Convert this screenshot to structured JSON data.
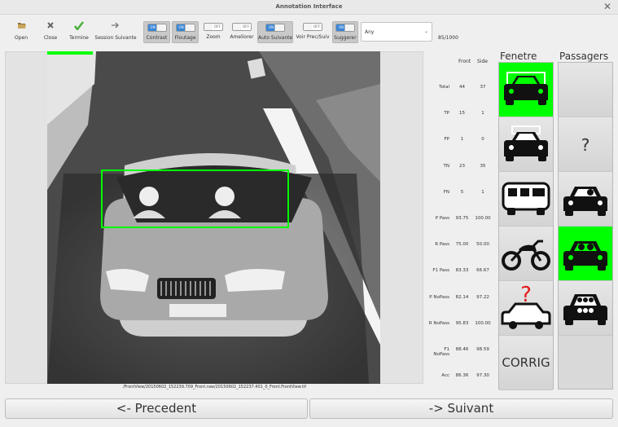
{
  "window": {
    "title": "Annotation Interface",
    "close_glyph": "✕"
  },
  "toolbar": {
    "open": "Open",
    "close": "Close",
    "termine": "Termine",
    "session_suivante": "Session Suivante",
    "contrast": "Contrast",
    "floutage": "Floutage",
    "zoom": "Zoom",
    "ameliorer": "Ameliorer",
    "auto_suivante": "Auto Suivante",
    "voir_prec_suiv": "Voir Prec/Suiv",
    "suggerer": "Suggerer",
    "toggle_on": "ON",
    "toggle_off": "OFF",
    "filter_value": "Any",
    "counter": "85/1000"
  },
  "image": {
    "filepath": "/FrontView/20150602_152239.709_Front.raw/20150602_152237.401_0_Front.FrontView.tif"
  },
  "stats": {
    "col_front": "Front",
    "col_side": "Side",
    "rows": [
      {
        "label": "Total",
        "front": "44",
        "side": "37"
      },
      {
        "label": "TP",
        "front": "15",
        "side": "1"
      },
      {
        "label": "FP",
        "front": "1",
        "side": "0"
      },
      {
        "label": "TN",
        "front": "23",
        "side": "35"
      },
      {
        "label": "FN",
        "front": "5",
        "side": "1"
      },
      {
        "label": "P Pass",
        "front": "93.75",
        "side": "100.00"
      },
      {
        "label": "R Pass",
        "front": "75.00",
        "side": "50.00"
      },
      {
        "label": "F1 Pass",
        "front": "83.33",
        "side": "66.67"
      },
      {
        "label": "P NoPass",
        "front": "82.14",
        "side": "97.22"
      },
      {
        "label": "R NoPass",
        "front": "95.83",
        "side": "100.00"
      },
      {
        "label": "F1 NoPass",
        "front": "88.46",
        "side": "98.59"
      },
      {
        "label": "Acc",
        "front": "86.36",
        "side": "97.30"
      }
    ]
  },
  "fenetre": {
    "title": "Fenetre",
    "items": [
      {
        "icon": "car-window-highlight-icon",
        "selected": true
      },
      {
        "icon": "car-roof-highlight-icon",
        "selected": false
      },
      {
        "icon": "bus-icon",
        "selected": false
      },
      {
        "icon": "motorcycle-icon",
        "selected": false
      },
      {
        "icon": "unknown-vehicle-icon",
        "selected": false,
        "mark": "?"
      },
      {
        "icon": "corrig-text",
        "selected": false,
        "label": "CORRIG"
      }
    ]
  },
  "passagers": {
    "title": "Passagers",
    "items": [
      {
        "icon": "blank",
        "selected": false
      },
      {
        "icon": "question-mark",
        "selected": false,
        "label": "?"
      },
      {
        "icon": "car-one-passenger-icon",
        "selected": false
      },
      {
        "icon": "car-two-passengers-icon",
        "selected": true
      },
      {
        "icon": "car-many-passengers-icon",
        "selected": false
      }
    ]
  },
  "navigation": {
    "prev": "<- Precedent",
    "next": "-> Suivant"
  },
  "colors": {
    "accent_blue": "#3a86d6",
    "selected_green": "#00ff00",
    "detection_box": "#00ff00"
  }
}
